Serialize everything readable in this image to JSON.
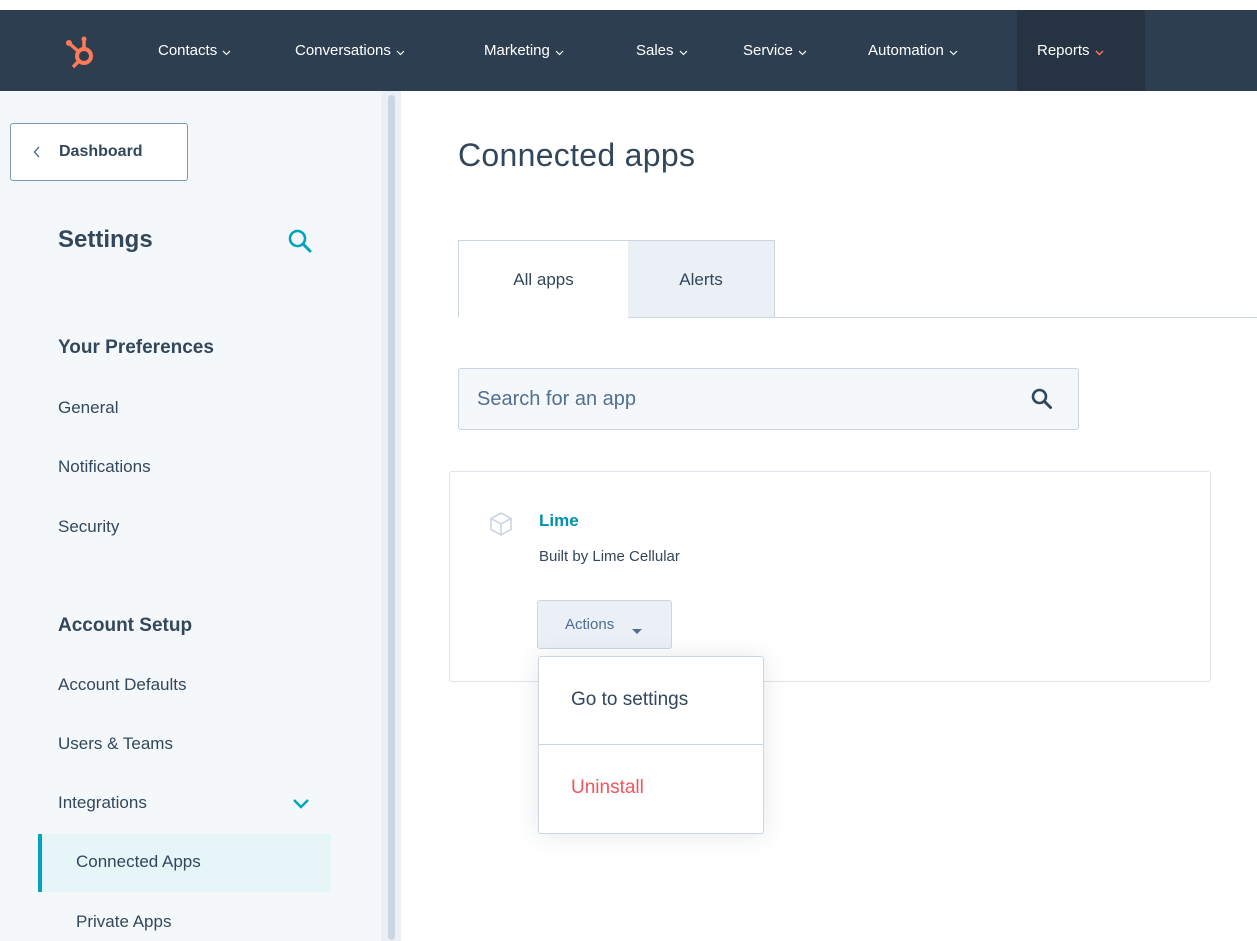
{
  "topnav": {
    "items": [
      {
        "label": "Contacts"
      },
      {
        "label": "Conversations"
      },
      {
        "label": "Marketing"
      },
      {
        "label": "Sales"
      },
      {
        "label": "Service"
      },
      {
        "label": "Automation"
      },
      {
        "label": "Reports"
      }
    ],
    "active_item": "Reports",
    "brand_icon": "hubspot-sprocket-icon",
    "colors": {
      "bar": "#2d3e50",
      "active_bg": "#253342",
      "accent": "#ff7a59"
    }
  },
  "sidebar": {
    "back_button": "Dashboard",
    "title": "Settings",
    "sections": [
      {
        "heading": "Your Preferences",
        "items": [
          "General",
          "Notifications",
          "Security"
        ]
      },
      {
        "heading": "Account Setup",
        "items": [
          "Account Defaults",
          "Users & Teams",
          "Integrations"
        ]
      }
    ],
    "integrations_subitems": [
      "Connected Apps",
      "Private Apps"
    ],
    "active_item": "Connected Apps"
  },
  "main": {
    "title": "Connected apps",
    "tabs": [
      {
        "label": "All apps",
        "selected": true
      },
      {
        "label": "Alerts",
        "selected": false
      }
    ],
    "search": {
      "placeholder": "Search for an app",
      "value": ""
    },
    "app": {
      "name": "Lime",
      "subtitle": "Built by Lime Cellular",
      "icon": "package-box-icon",
      "actions_label": "Actions"
    },
    "menu": {
      "items": [
        {
          "label": "Go to settings",
          "color": "#33475b"
        },
        {
          "label": "Uninstall",
          "color": "#f2545b"
        }
      ]
    }
  }
}
